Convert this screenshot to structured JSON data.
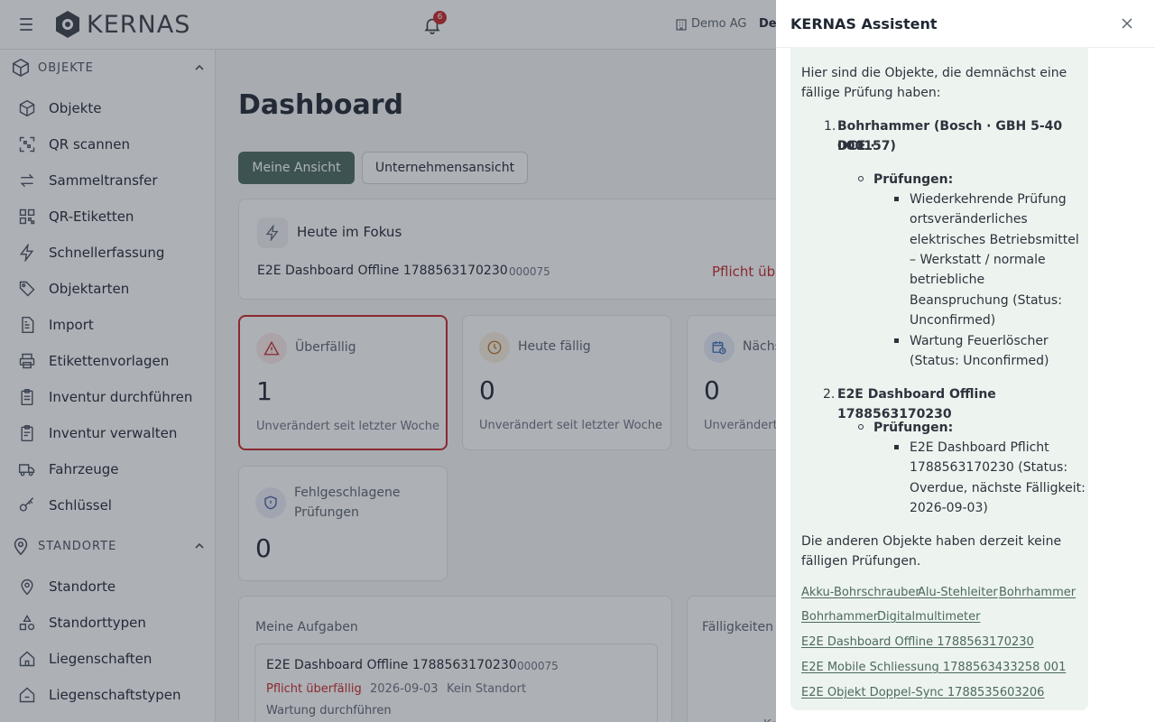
{
  "app": {
    "logo_text": "KERNAS"
  },
  "topbar": {
    "notification_count": "6",
    "company": "Demo AG",
    "user_short": "De"
  },
  "sidebar": {
    "sections": [
      {
        "label": "OBJEKTE",
        "items": [
          "Objekte",
          "QR scannen",
          "Sammeltransfer",
          "QR-Etiketten",
          "Schnellerfassung",
          "Objektarten",
          "Import",
          "Etikettenvorlagen",
          "Inventur durchführen",
          "Inventur verwalten",
          "Fahrzeuge",
          "Schlüssel"
        ]
      },
      {
        "label": "STANDORTE",
        "items": [
          "Standorte",
          "Standorttypen",
          "Liegenschaften",
          "Liegenschaftstypen"
        ]
      }
    ]
  },
  "main": {
    "title": "Dashboard",
    "views": {
      "mine": "Meine Ansicht",
      "company": "Unternehmensansicht"
    },
    "focus": {
      "title": "Heute im Fokus",
      "item_name": "E2E Dashboard Offline 1788563170230",
      "item_number": "000075",
      "status": "Pflicht üb"
    },
    "kpis": {
      "overdue": {
        "title": "Überfällig",
        "value": "1",
        "sub": "Unverändert seit letzter Woche"
      },
      "today": {
        "title": "Heute fällig",
        "value": "0",
        "sub": "Unverändert seit letzter Woche"
      },
      "next": {
        "title": "Nächs",
        "value": "0",
        "sub": "Unverändert s"
      },
      "failed": {
        "title": "Fehlgeschlagene Prüfungen",
        "value": "0"
      }
    },
    "tasks": {
      "heading": "Meine Aufgaben",
      "item": {
        "name": "E2E Dashboard Offline 1788563170230",
        "number": "000075",
        "status": "Pflicht überfällig",
        "date": "2026-09-03",
        "location": "Kein Standort",
        "action": "Wartung durchführen"
      }
    },
    "dues": {
      "heading": "Fälligkeiten &",
      "tail": "Ke"
    }
  },
  "assistant": {
    "title": "KERNAS Assistent",
    "intro_1": "Hier sind die Objekte, die demnächst eine",
    "intro_2": "fällige Prüfung haben:",
    "item1_line1": "Bohrhammer (Bosch · GBH 5-40 DCE ·",
    "item1_line2": "000157)",
    "checks_label": "Prüfungen:",
    "item1_check1_lines": [
      "Wiederkehrende Prüfung",
      "ortsveränderliches",
      "elektrisches Betriebsmittel",
      "– Werkstatt / normale",
      "betriebliche",
      "Beanspruchung (Status:",
      "Unconfirmed)"
    ],
    "item1_check2_lines": [
      "Wartung Feuerlöscher",
      "(Status: Unconfirmed)"
    ],
    "item2_line1": "E2E Dashboard Offline 1788563170230",
    "item2_check1_lines": [
      "E2E Dashboard Pflicht",
      "1788563170230 (Status:",
      "Overdue, nächste Fälligkeit:",
      "2026-09-03)"
    ],
    "outro_1": "Die anderen Objekte haben derzeit keine",
    "outro_2": "fälligen Prüfungen.",
    "links": [
      "Akku-Bohrschrauber",
      "Alu-Stehleiter",
      "Bohrhammer",
      "Bohrhammer",
      "Digitalmultimeter",
      "E2E Dashboard Offline 1788563170230",
      "E2E Mobile Schliessung 1788563433258 001",
      "E2E Objekt Doppel-Sync 1788535603206"
    ]
  }
}
